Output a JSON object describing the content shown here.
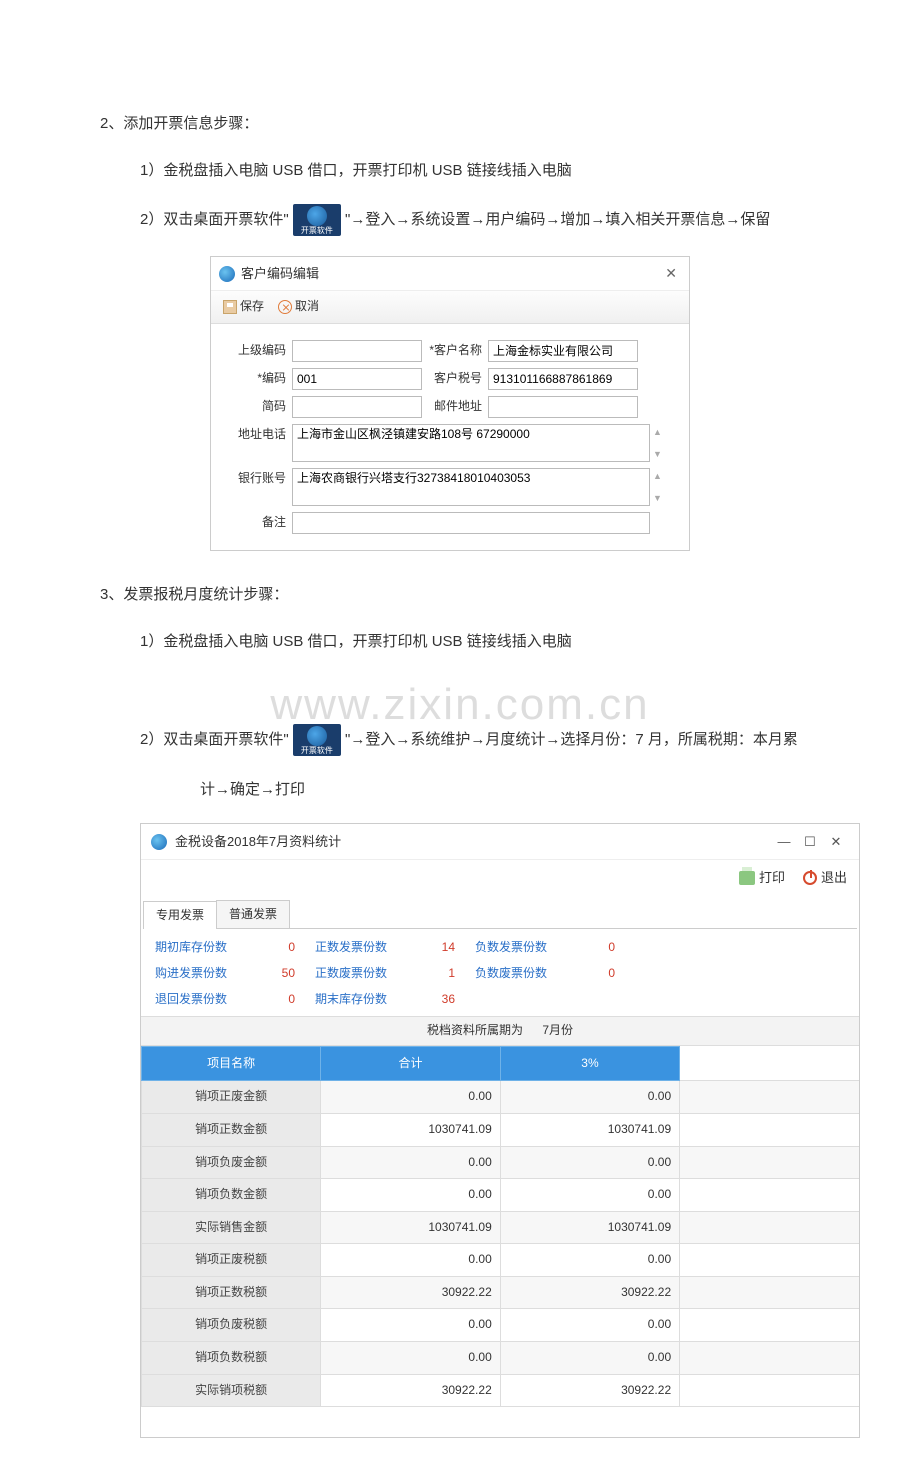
{
  "doc": {
    "section2_title": "2、添加开票信息步骤：",
    "section2_step1": "1）金税盘插入电脑 USB 借口，开票打印机 USB 链接线插入电脑",
    "section2_step2a": "2）双击桌面开票软件\"",
    "section2_step2b": "\"→登入→系统设置→用户编码→增加→填入相关开票信息→保留",
    "section3_title": "3、发票报税月度统计步骤：",
    "section3_step1": "1）金税盘插入电脑 USB 借口，开票打印机 USB 链接线插入电脑",
    "section3_step2a": "2）双击桌面开票软件\"",
    "section3_step2b": "\"→登入→系统维护→月度统计→选择月份：7 月，所属税期：本月累",
    "section3_step2c": "计→确定→打印"
  },
  "dialog": {
    "title": "客户编码编辑",
    "save": "保存",
    "cancel": "取消",
    "labels": {
      "parent_code": "上级编码",
      "customer_name": "*客户名称",
      "code": "*编码",
      "tax_no": "客户税号",
      "shortcode": "简码",
      "postal": "邮件地址",
      "addr_phone": "地址电话",
      "bank_acc": "银行账号",
      "remark": "备注"
    },
    "values": {
      "parent_code": "",
      "customer_name": "上海金标实业有限公司",
      "code": "001",
      "tax_no": "913101166887861869",
      "shortcode": "",
      "postal": "",
      "addr_phone": "上海市金山区枫泾镇建安路108号 67290000",
      "bank_acc": "上海农商银行兴塔支行32738418010403053",
      "remark": ""
    }
  },
  "watermark": "www.zixin.com.cn",
  "stats_window": {
    "title": "金税设备2018年7月资料统计",
    "print": "打印",
    "exit": "退出",
    "tabs": {
      "special": "专用发票",
      "normal": "普通发票"
    },
    "summary": {
      "l1": "期初库存份数",
      "v1": "0",
      "l2": "正数发票份数",
      "v2": "14",
      "l3": "负数发票份数",
      "v3": "0",
      "l4": "购进发票份数",
      "v4": "50",
      "l5": "正数废票份数",
      "v5": "1",
      "l6": "负数废票份数",
      "v6": "0",
      "l7": "退回发票份数",
      "v7": "0",
      "l8": "期末库存份数",
      "v8": "36"
    },
    "period_label": "税档资料所属期为",
    "period_value": "7月份",
    "grid": {
      "headers": {
        "item": "项目名称",
        "total": "合计",
        "rate": "3%"
      },
      "rows": [
        {
          "label": "销项正废金额",
          "total": "0.00",
          "rate": "0.00"
        },
        {
          "label": "销项正数金额",
          "total": "1030741.09",
          "rate": "1030741.09"
        },
        {
          "label": "销项负废金额",
          "total": "0.00",
          "rate": "0.00"
        },
        {
          "label": "销项负数金额",
          "total": "0.00",
          "rate": "0.00"
        },
        {
          "label": "实际销售金额",
          "total": "1030741.09",
          "rate": "1030741.09"
        },
        {
          "label": "销项正废税额",
          "total": "0.00",
          "rate": "0.00"
        },
        {
          "label": "销项正数税额",
          "total": "30922.22",
          "rate": "30922.22"
        },
        {
          "label": "销项负废税额",
          "total": "0.00",
          "rate": "0.00"
        },
        {
          "label": "销项负数税额",
          "total": "0.00",
          "rate": "0.00"
        },
        {
          "label": "实际销项税额",
          "total": "30922.22",
          "rate": "30922.22"
        }
      ]
    }
  }
}
